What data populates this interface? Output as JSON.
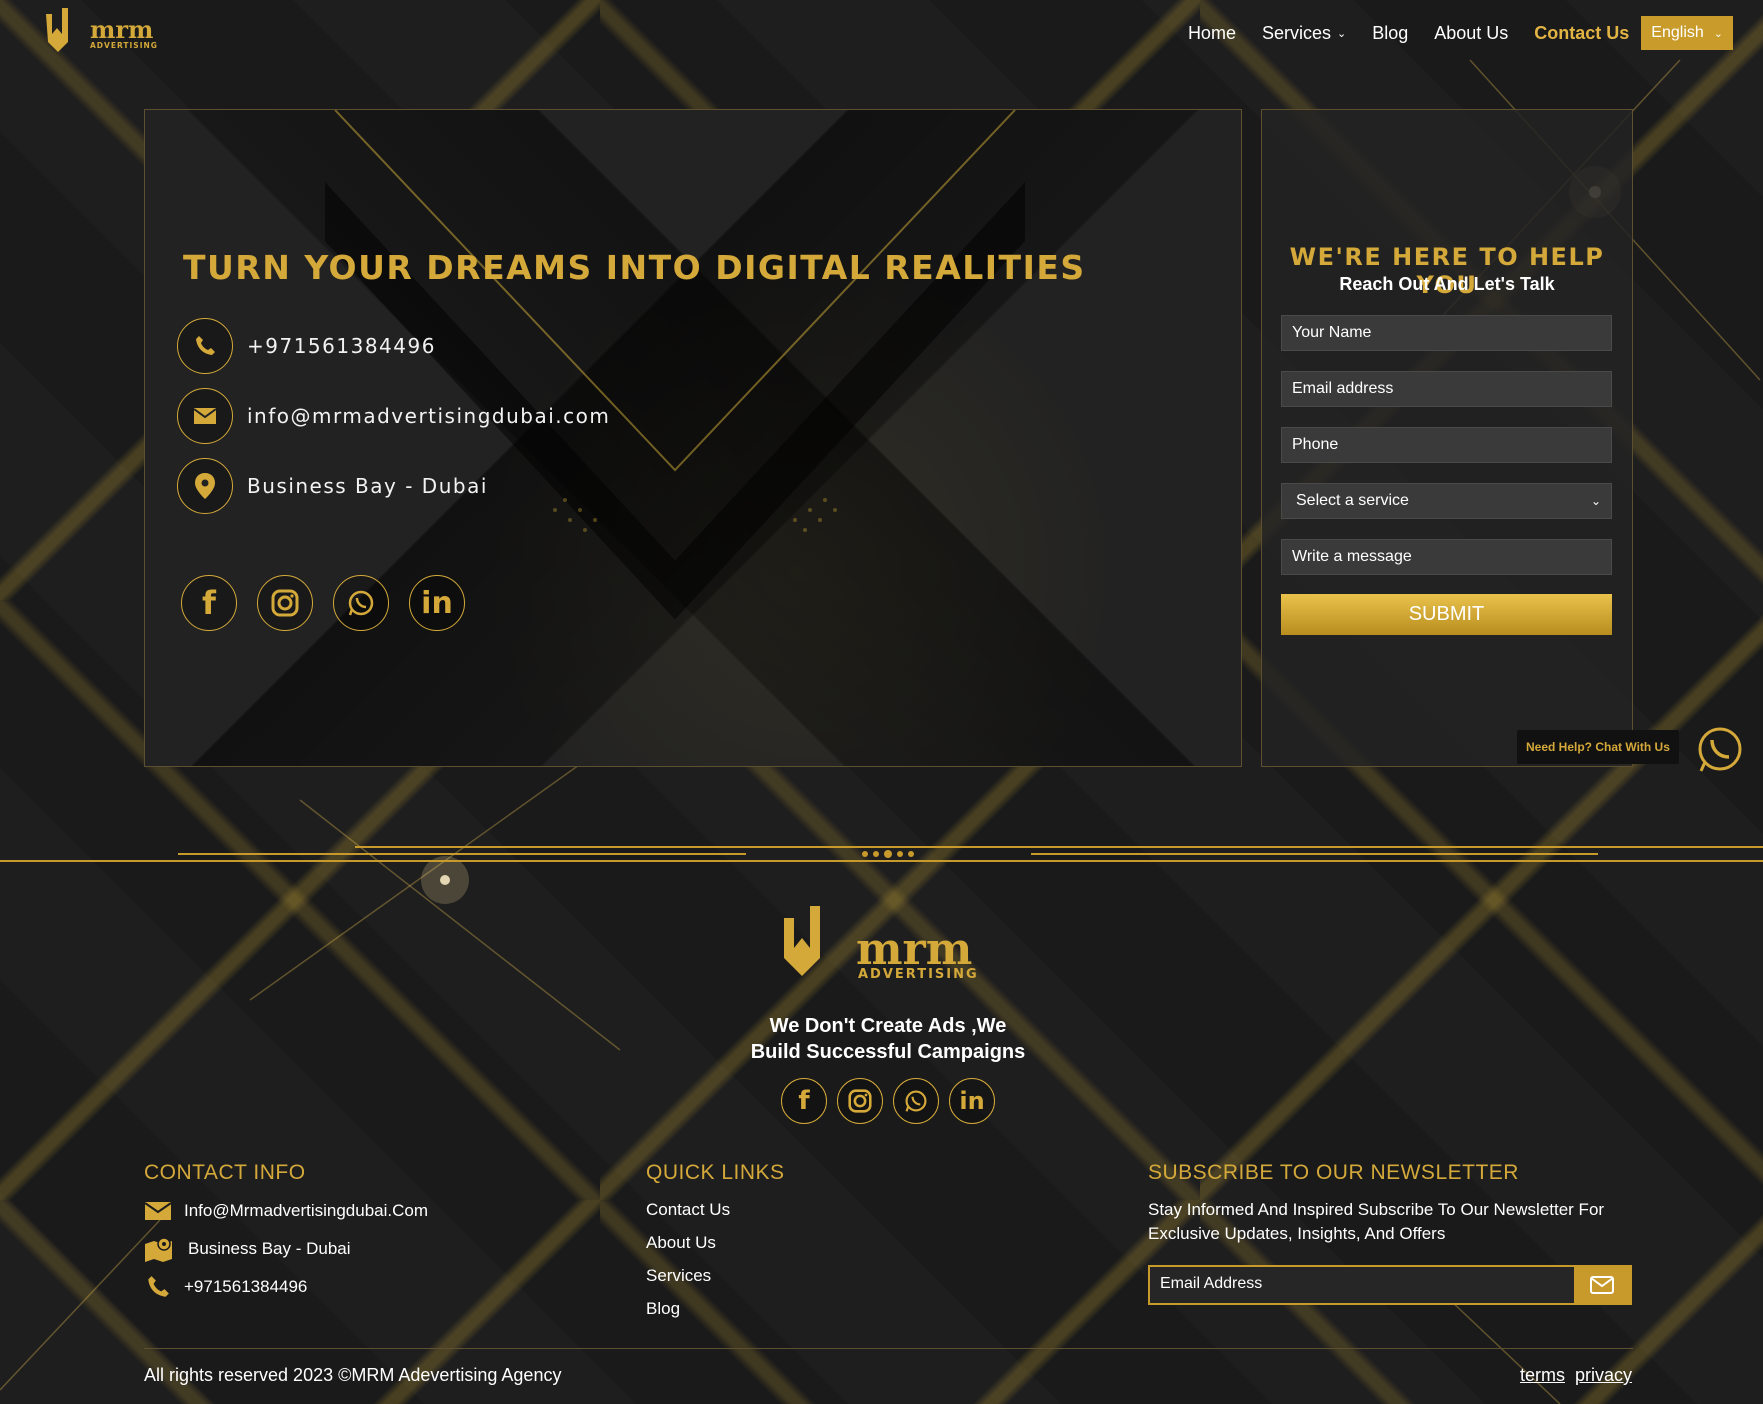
{
  "brand": {
    "logo_main": "mrm",
    "logo_sub": "ADVERTISING"
  },
  "nav": {
    "items": [
      {
        "label": "Home"
      },
      {
        "label": "Services"
      },
      {
        "label": "Blog"
      },
      {
        "label": "About Us"
      },
      {
        "label": "Contact Us"
      }
    ],
    "language": "English"
  },
  "hero": {
    "title": "TURN YOUR DREAMS INTO DIGITAL REALITIES",
    "phone": "+971561384496",
    "email": "info@mrmadvertisingdubai.com",
    "location": "Business Bay - Dubai"
  },
  "form": {
    "title": "WE'RE HERE TO HELP YOU",
    "subtitle": "Reach Out And Let's Talk",
    "name_placeholder": "Your Name",
    "email_placeholder": "Email address",
    "phone_placeholder": "Phone",
    "service_selected": "Select a service",
    "message_placeholder": "Write a message",
    "submit_label": "SUBMIT"
  },
  "chat": {
    "label": "Need Help? Chat With Us"
  },
  "footer": {
    "tagline_line1": "We Don't Create Ads ,We",
    "tagline_line2": "Build Successful Campaigns",
    "contact_title": "CONTACT INFO",
    "contact_email": "Info@Mrmadvertisingdubai.Com",
    "contact_location": "Business Bay - Dubai",
    "contact_phone": "+971561384496",
    "links_title": "QUICK LINKS",
    "links": [
      {
        "label": "Contact Us"
      },
      {
        "label": "About Us"
      },
      {
        "label": "Services"
      },
      {
        "label": "Blog"
      }
    ],
    "newsletter_title": "SUBSCRIBE TO OUR NEWSLETTER",
    "newsletter_text": "Stay Informed And Inspired Subscribe To Our Newsletter For Exclusive Updates, Insights, And Offers",
    "newsletter_placeholder": "Email Address",
    "copyright": "All rights reserved 2023 ©MRM Adevertising Agency",
    "terms": "terms",
    "privacy": "privacy"
  },
  "colors": {
    "accent": "#d4a93a",
    "background": "#1b1b1b"
  }
}
